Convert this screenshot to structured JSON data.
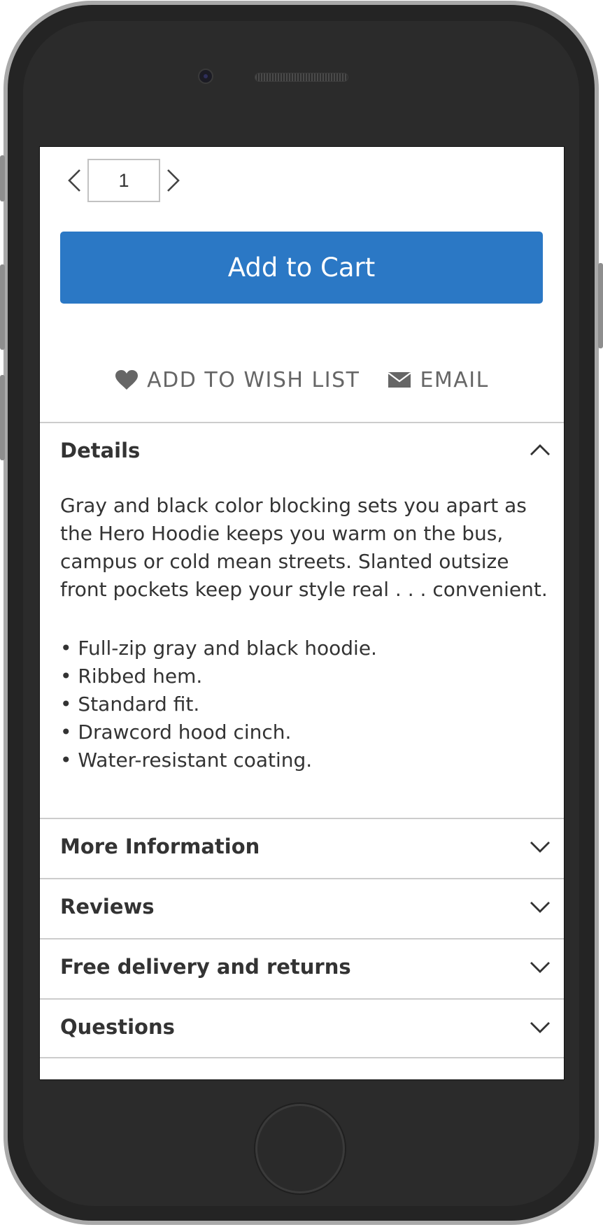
{
  "quantity": {
    "value": "1"
  },
  "add_to_cart": {
    "label": "Add to Cart"
  },
  "actions": {
    "wishlist_label": "Add to Wish List",
    "email_label": "Email"
  },
  "details": {
    "title": "Details",
    "description": "Gray and black color blocking sets you apart as the Hero Hoodie keeps you warm on the bus, campus or cold mean streets. Slanted outsize front pockets keep your style real . . . convenient.",
    "features": [
      "• Full-zip gray and black hoodie.",
      "• Ribbed hem.",
      "• Standard fit.",
      "• Drawcord hood cinch.",
      "• Water-resistant coating."
    ]
  },
  "sections": [
    {
      "title": "More Information"
    },
    {
      "title": "Reviews"
    },
    {
      "title": "Free delivery and returns"
    },
    {
      "title": "Questions"
    }
  ],
  "colors": {
    "button_blue": "#2b78c5",
    "text": "#333333",
    "muted": "#666666",
    "divider": "#cccccc"
  }
}
